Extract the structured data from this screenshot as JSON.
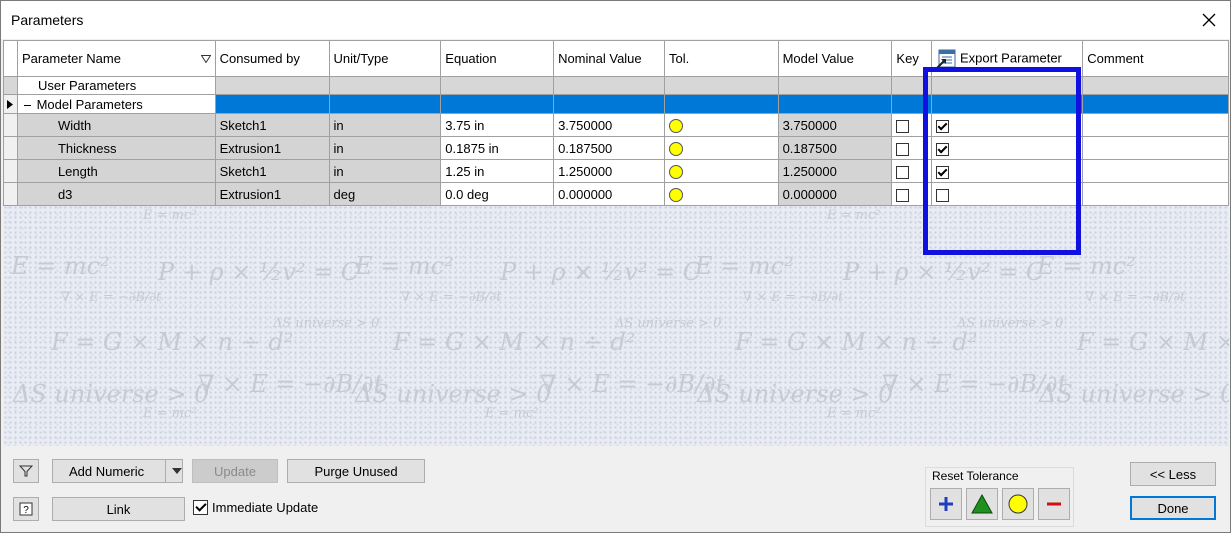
{
  "window": {
    "title": "Parameters"
  },
  "columns": [
    "Parameter Name",
    "Consumed by",
    "Unit/Type",
    "Equation",
    "Nominal Value",
    "Tol.",
    "Model Value",
    "Key",
    "Export Parameter",
    "Comment"
  ],
  "groups": {
    "user": "User Parameters",
    "model": "Model Parameters"
  },
  "rows": [
    {
      "name": "Width",
      "consumed_by": "Sketch1",
      "unit": "in",
      "equation": "3.75 in",
      "nominal": "3.750000",
      "model": "3.750000",
      "key": false,
      "export": true
    },
    {
      "name": "Thickness",
      "consumed_by": "Extrusion1",
      "unit": "in",
      "equation": "0.1875 in",
      "nominal": "0.187500",
      "model": "0.187500",
      "key": false,
      "export": true
    },
    {
      "name": "Length",
      "consumed_by": "Sketch1",
      "unit": "in",
      "equation": "1.25 in",
      "nominal": "1.250000",
      "model": "1.250000",
      "key": false,
      "export": true
    },
    {
      "name": "d3",
      "consumed_by": "Extrusion1",
      "unit": "deg",
      "equation": "0.0 deg",
      "nominal": "0.000000",
      "model": "0.000000",
      "key": false,
      "export": false
    }
  ],
  "tolerance_color": "#ffff00",
  "highlight_color": "#1010e0",
  "selection_color": "#0078d7",
  "watermark": {
    "large": [
      "E = mc²",
      "P + ρ × ½v² = C",
      "F = G × M × n ÷ d²",
      "∇ × E = −∂B/∂t",
      "ΔS universe > 0"
    ],
    "small": [
      "E = mc²",
      "∇ × E = −∂B/∂t",
      "ΔS universe > 0"
    ]
  },
  "footer": {
    "add_numeric": "Add Numeric",
    "update": "Update",
    "purge_unused": "Purge Unused",
    "link": "Link",
    "immediate_update": "Immediate Update",
    "immediate_update_checked": true,
    "reset_tolerance": "Reset Tolerance",
    "less": "<< Less",
    "done": "Done"
  },
  "icons": [
    "close-icon",
    "filter-icon",
    "help-icon",
    "dropdown-arrow-icon",
    "export-parameter-icon",
    "plus-icon",
    "triangle-icon",
    "circle-icon",
    "minus-icon",
    "row-pointer-icon",
    "tree-collapse-icon"
  ]
}
